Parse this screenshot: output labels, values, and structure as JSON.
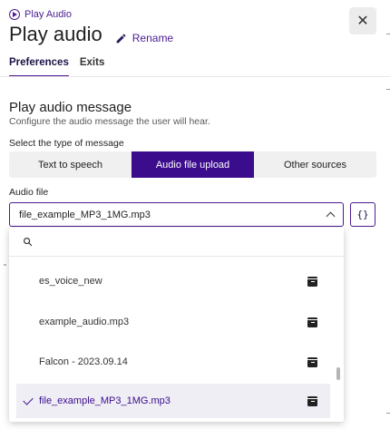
{
  "header": {
    "kicker": "Play Audio",
    "title": "Play audio",
    "rename_label": "Rename",
    "close_label": "✕"
  },
  "tabs": [
    {
      "label": "Preferences",
      "active": true
    },
    {
      "label": "Exits",
      "active": false
    }
  ],
  "section": {
    "title": "Play audio message",
    "description": "Configure the audio message the user will hear.",
    "type_label": "Select the type of message"
  },
  "message_types": [
    {
      "label": "Text to speech",
      "active": false
    },
    {
      "label": "Audio file upload",
      "active": true
    },
    {
      "label": "Other sources",
      "active": false
    }
  ],
  "audio_file": {
    "label": "Audio file",
    "selected_value": "file_example_MP3_1MG.mp3",
    "variable_button": "{}"
  },
  "dropdown": {
    "search_placeholder": "",
    "search_value": "",
    "items": [
      {
        "label": "es_voice_new",
        "selected": false
      },
      {
        "label": "example_audio.mp3",
        "selected": false
      },
      {
        "label": "Falcon - 2023.09.14",
        "selected": false
      },
      {
        "label": "file_example_MP3_1MG.mp3",
        "selected": true
      }
    ]
  },
  "colors": {
    "accent": "#4b1c94",
    "segment_active": "#3b0c8c",
    "selected_row": "#efeef5"
  },
  "icons": {
    "kicker": "play-circle-icon",
    "rename": "pencil-icon",
    "close": "close-icon",
    "select": "chevron-up-icon",
    "search": "search-icon",
    "item_action": "archive-icon",
    "selected_mark": "check-icon"
  }
}
